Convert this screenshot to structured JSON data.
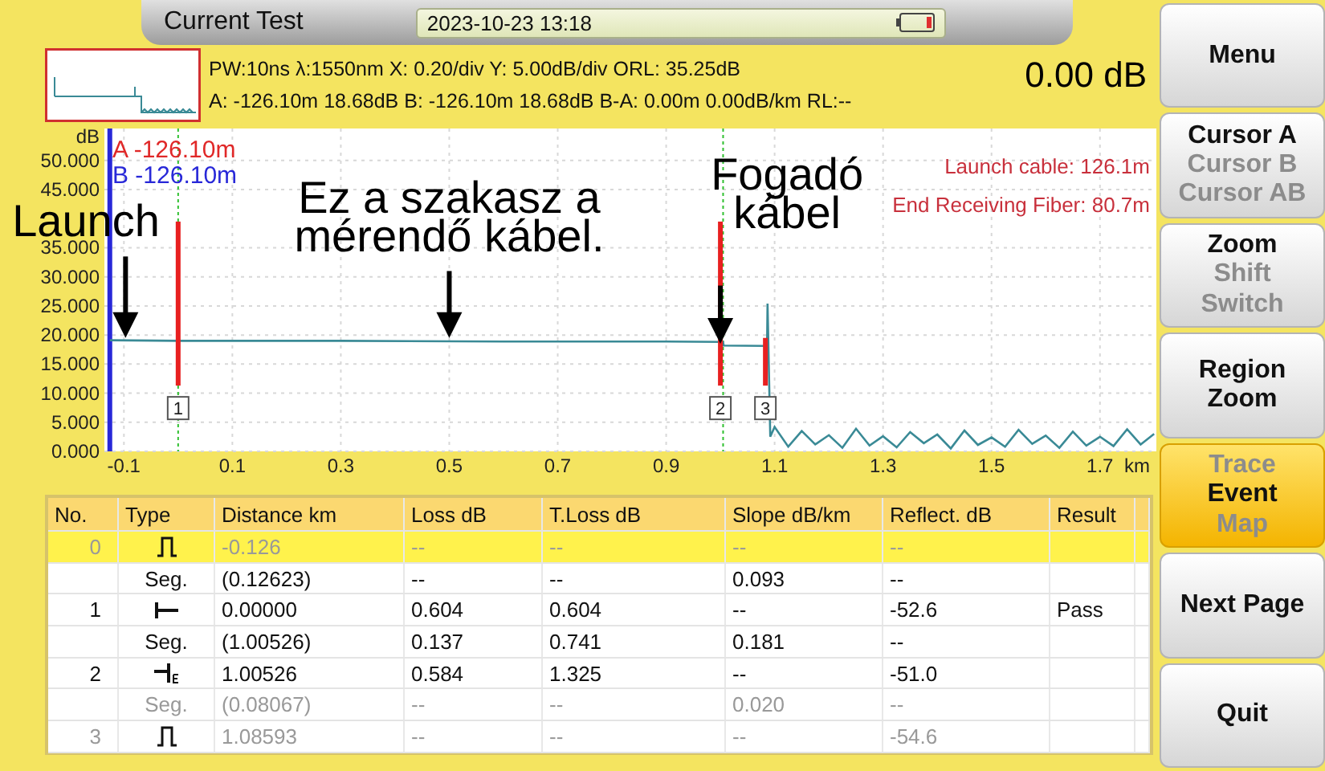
{
  "header": {
    "title": "Current Test",
    "datetime": "2023-10-23 13:18"
  },
  "info": {
    "line1": "PW:10ns λ:1550nm  X: 0.20/div Y: 5.00dB/div ORL: 35.25dB",
    "line2": "A: -126.10m 18.68dB B: -126.10m 18.68dB B-A: 0.00m 0.00dB/km RL:--",
    "reading": "0.00 dB"
  },
  "chart": {
    "chart_data": {
      "type": "line",
      "xlabel": "km",
      "ylabel": "dB",
      "xlim": [
        -0.136,
        1.804
      ],
      "ylim": [
        0,
        55.5
      ],
      "grid": true,
      "ref_lines": [
        {
          "axis": "x",
          "value": 0.0,
          "color": "#30c030"
        },
        {
          "axis": "x",
          "value": 1.005,
          "color": "#30c030"
        },
        {
          "axis": "x",
          "value": -0.126,
          "color": "#2828d8"
        }
      ],
      "xticks": [
        -0.1,
        0.1,
        0.3,
        0.5,
        0.7,
        0.9,
        1.1,
        1.3,
        1.5,
        1.7
      ],
      "yticks": [
        {
          "value": 0,
          "label": "0.000"
        },
        {
          "value": 5,
          "label": "5.000"
        },
        {
          "value": 10,
          "label": "10.000"
        },
        {
          "value": 15,
          "label": "15.000"
        },
        {
          "value": 20,
          "label": "20.000"
        },
        {
          "value": 25,
          "label": "25.000"
        },
        {
          "value": 30,
          "label": "30.000"
        },
        {
          "value": 35,
          "label": "35.000"
        },
        {
          "value": 45,
          "label": "45.000"
        },
        {
          "value": 50,
          "label": "50.000"
        }
      ],
      "series": [
        {
          "color": "#3a8a96",
          "x": [
            -0.126,
            0.0,
            0.3,
            0.6,
            0.9,
            1.005,
            1.006,
            1.086,
            1.087,
            1.092,
            1.1,
            1.125,
            1.15,
            1.175,
            1.2,
            1.225,
            1.25,
            1.275,
            1.3,
            1.325,
            1.35,
            1.375,
            1.4,
            1.425,
            1.45,
            1.475,
            1.5,
            1.525,
            1.55,
            1.575,
            1.6,
            1.625,
            1.65,
            1.675,
            1.7,
            1.725,
            1.75,
            1.775,
            1.8
          ],
          "values": [
            19.1,
            19.0,
            19.0,
            18.9,
            18.9,
            18.8,
            18.2,
            18.1,
            25.4,
            2.5,
            4.2,
            0.8,
            3.5,
            1.2,
            2.8,
            0.6,
            3.9,
            1.0,
            2.6,
            0.7,
            3.3,
            1.4,
            2.9,
            0.5,
            3.6,
            1.1,
            2.4,
            0.8,
            3.7,
            1.3,
            2.7,
            0.6,
            3.4,
            1.0,
            2.5,
            0.9,
            3.8,
            1.2,
            3.0
          ]
        }
      ]
    },
    "cursors": [
      {
        "label": "A -126.10m",
        "color": "#e02828"
      },
      {
        "label": "B -126.10m",
        "color": "#2828d8"
      }
    ],
    "events": [
      {
        "label": "1"
      },
      {
        "label": "2"
      },
      {
        "label": "3"
      }
    ],
    "legend": [
      "Launch cable: 126.1m",
      "End Receiving Fiber: 80.7m"
    ],
    "notes": [
      {
        "lines": [
          "Launch"
        ]
      },
      {
        "lines": [
          "Ez a szakasz a",
          "mérendő kábel."
        ]
      },
      {
        "lines": [
          "Fogadó",
          "kábel"
        ]
      }
    ]
  },
  "table": {
    "columns": [
      "No.",
      "Type",
      "Distance km",
      "Loss dB",
      "T.Loss dB",
      "Slope dB/km",
      "Reflect. dB",
      "Result"
    ],
    "rows": [
      {
        "kind": "reflective",
        "selected": true,
        "dimmed": true,
        "cells": [
          "0",
          "",
          "-0.126",
          "--",
          "--",
          "--",
          "--"
        ]
      },
      {
        "kind": "segment",
        "selected": false,
        "dimmed": false,
        "cells": [
          "",
          "Seg.",
          "(0.12623)",
          "--",
          "--",
          "0.093",
          "--"
        ]
      },
      {
        "kind": "start",
        "selected": false,
        "dimmed": false,
        "cells": [
          "1",
          "",
          "0.00000",
          "0.604",
          "0.604",
          "--",
          "-52.6",
          "Pass"
        ]
      },
      {
        "kind": "segment",
        "selected": false,
        "dimmed": false,
        "cells": [
          "",
          "Seg.",
          "(1.00526)",
          "0.137",
          "0.741",
          "0.181",
          "--"
        ]
      },
      {
        "kind": "end",
        "selected": false,
        "dimmed": false,
        "cells": [
          "2",
          "",
          "1.00526",
          "0.584",
          "1.325",
          "--",
          "-51.0"
        ]
      },
      {
        "kind": "segment",
        "selected": false,
        "dimmed": true,
        "cells": [
          "",
          "Seg.",
          "(0.08067)",
          "--",
          "--",
          "0.020",
          "--"
        ]
      },
      {
        "kind": "reflective",
        "selected": false,
        "dimmed": true,
        "cells": [
          "3",
          "",
          "1.08593",
          "--",
          "--",
          "--",
          "-54.6"
        ]
      }
    ]
  },
  "softkeys": [
    {
      "kind": "label",
      "label": "Menu",
      "active": false
    },
    {
      "kind": "options",
      "active": false,
      "options": [
        {
          "label": "Cursor A",
          "selected": true
        },
        {
          "label": "Cursor B",
          "selected": false
        },
        {
          "label": "Cursor AB",
          "selected": false
        }
      ]
    },
    {
      "kind": "options",
      "active": false,
      "options": [
        {
          "label": "Zoom",
          "selected": true
        },
        {
          "label": "Shift",
          "selected": false
        },
        {
          "label": "Switch",
          "selected": false
        }
      ]
    },
    {
      "kind": "label",
      "label": "Region Zoom",
      "active": false
    },
    {
      "kind": "options",
      "active": true,
      "options": [
        {
          "label": "Trace",
          "selected": false
        },
        {
          "label": "Event",
          "selected": true
        },
        {
          "label": "Map",
          "selected": false
        }
      ]
    },
    {
      "kind": "label",
      "label": "Next Page",
      "active": false
    },
    {
      "kind": "label",
      "label": "Quit",
      "active": false
    }
  ]
}
